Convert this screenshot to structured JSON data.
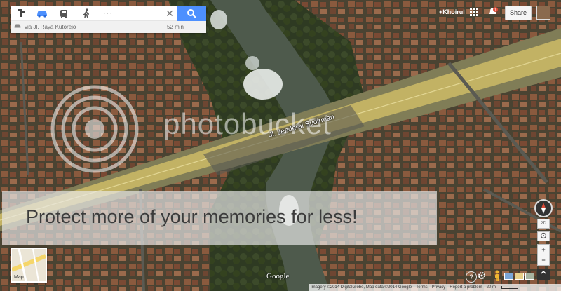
{
  "directions": {
    "modes": [
      {
        "name": "route-toggle-icon"
      },
      {
        "name": "car-icon",
        "active": true
      },
      {
        "name": "transit-icon"
      },
      {
        "name": "walk-icon"
      },
      {
        "name": "more-modes-icon",
        "glyph": "···"
      }
    ],
    "close_glyph": "✕",
    "route_summary": "via Jl. Raya Kutorejo",
    "route_time": "52 min"
  },
  "account": {
    "user_name": "+Khoirul",
    "notification_count": "1",
    "share_label": "Share"
  },
  "map": {
    "road_label": "Jl. Jenderal Sudirman",
    "google_logo": "Google",
    "thumbnail_label": "Map",
    "attribution": "Imagery ©2014 DigitalGlobe, Map data ©2014 Google",
    "terms": "Terms",
    "privacy": "Privacy",
    "report": "Report a problem",
    "scale": "20 m",
    "controls": {
      "tilt": "2D",
      "zoom_in": "+",
      "zoom_out": "−",
      "help": "?"
    }
  },
  "watermark": {
    "brand": "photobucket",
    "promo": "Protect more of your memories for less!"
  },
  "colors": {
    "accent_blue": "#4d90fe",
    "road_yellow": "#d8c468"
  }
}
